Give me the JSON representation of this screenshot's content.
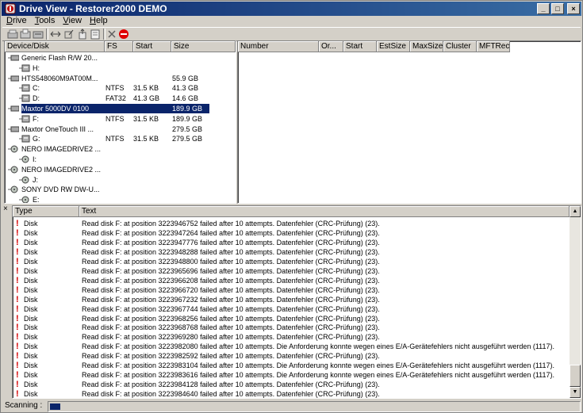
{
  "window": {
    "title": "Drive View - Restorer2000 DEMO"
  },
  "menu": [
    "Drive",
    "Tools",
    "View",
    "Help"
  ],
  "toolbar": {
    "icons": [
      "open-drive-icon",
      "open-image-icon",
      "save-icon",
      "swap-icon",
      "edit-icon",
      "export-icon",
      "properties-icon",
      "delete-icon",
      "stop-icon"
    ]
  },
  "tree": {
    "headers": [
      "Device/Disk",
      "FS",
      "Start",
      "Size"
    ],
    "rows": [
      {
        "name": "Generic Flash R/W 20...",
        "fs": "",
        "start": "",
        "size": "",
        "level": 0,
        "kind": "disk"
      },
      {
        "name": "H:",
        "fs": "",
        "start": "",
        "size": "",
        "level": 1,
        "kind": "partition"
      },
      {
        "name": "HTS548060M9AT00M...",
        "fs": "",
        "start": "",
        "size": "55.9 GB",
        "level": 0,
        "kind": "disk"
      },
      {
        "name": "C:",
        "fs": "NTFS",
        "start": "31.5 KB",
        "size": "41.3 GB",
        "level": 1,
        "kind": "partition"
      },
      {
        "name": "D:",
        "fs": "FAT32",
        "start": "41.3 GB",
        "size": "14.6 GB",
        "level": 1,
        "kind": "partition"
      },
      {
        "name": "Maxtor 5000DV 0100",
        "fs": "",
        "start": "",
        "size": "189.9 GB",
        "level": 0,
        "kind": "disk",
        "selected": true
      },
      {
        "name": "F:",
        "fs": "NTFS",
        "start": "31.5 KB",
        "size": "189.9 GB",
        "level": 1,
        "kind": "partition"
      },
      {
        "name": "Maxtor OneTouch III ...",
        "fs": "",
        "start": "",
        "size": "279.5 GB",
        "level": 0,
        "kind": "disk"
      },
      {
        "name": "G:",
        "fs": "NTFS",
        "start": "31.5 KB",
        "size": "279.5 GB",
        "level": 1,
        "kind": "partition"
      },
      {
        "name": "NERO IMAGEDRIVE2 ...",
        "fs": "",
        "start": "",
        "size": "",
        "level": 0,
        "kind": "cd"
      },
      {
        "name": "I:",
        "fs": "",
        "start": "",
        "size": "",
        "level": 1,
        "kind": "cd"
      },
      {
        "name": "NERO IMAGEDRIVE2 ...",
        "fs": "",
        "start": "",
        "size": "",
        "level": 0,
        "kind": "cd"
      },
      {
        "name": "J:",
        "fs": "",
        "start": "",
        "size": "",
        "level": 1,
        "kind": "cd"
      },
      {
        "name": "SONY DVD RW DW-U...",
        "fs": "",
        "start": "",
        "size": "",
        "level": 0,
        "kind": "cd"
      },
      {
        "name": "E:",
        "fs": "",
        "start": "",
        "size": "",
        "level": 1,
        "kind": "cd"
      }
    ]
  },
  "details": {
    "headers": [
      "Number",
      "Or...",
      "Start",
      "EstSize",
      "MaxSize",
      "Cluster",
      "MFTRec"
    ]
  },
  "log": {
    "close_glyph": "×",
    "scroll_up_glyph": "▲",
    "scroll_down_glyph": "▼",
    "headers": [
      "Type",
      "Text"
    ],
    "rows": [
      {
        "type": "Disk",
        "text": "Read disk F: at position 3223946752 failed after 10 attempts. Datenfehler (CRC-Prüfung) (23)."
      },
      {
        "type": "Disk",
        "text": "Read disk F: at position 3223947264 failed after 10 attempts. Datenfehler (CRC-Prüfung) (23)."
      },
      {
        "type": "Disk",
        "text": "Read disk F: at position 3223947776 failed after 10 attempts. Datenfehler (CRC-Prüfung) (23)."
      },
      {
        "type": "Disk",
        "text": "Read disk F: at position 3223948288 failed after 10 attempts. Datenfehler (CRC-Prüfung) (23)."
      },
      {
        "type": "Disk",
        "text": "Read disk F: at position 3223948800 failed after 10 attempts. Datenfehler (CRC-Prüfung) (23)."
      },
      {
        "type": "Disk",
        "text": "Read disk F: at position 3223965696 failed after 10 attempts. Datenfehler (CRC-Prüfung) (23)."
      },
      {
        "type": "Disk",
        "text": "Read disk F: at position 3223966208 failed after 10 attempts. Datenfehler (CRC-Prüfung) (23)."
      },
      {
        "type": "Disk",
        "text": "Read disk F: at position 3223966720 failed after 10 attempts. Datenfehler (CRC-Prüfung) (23)."
      },
      {
        "type": "Disk",
        "text": "Read disk F: at position 3223967232 failed after 10 attempts. Datenfehler (CRC-Prüfung) (23)."
      },
      {
        "type": "Disk",
        "text": "Read disk F: at position 3223967744 failed after 10 attempts. Datenfehler (CRC-Prüfung) (23)."
      },
      {
        "type": "Disk",
        "text": "Read disk F: at position 3223968256 failed after 10 attempts. Datenfehler (CRC-Prüfung) (23)."
      },
      {
        "type": "Disk",
        "text": "Read disk F: at position 3223968768 failed after 10 attempts. Datenfehler (CRC-Prüfung) (23)."
      },
      {
        "type": "Disk",
        "text": "Read disk F: at position 3223969280 failed after 10 attempts. Datenfehler (CRC-Prüfung) (23)."
      },
      {
        "type": "Disk",
        "text": "Read disk F: at position 3223982080 failed after 10 attempts. Die Anforderung konnte wegen eines E/A-Gerätefehlers nicht ausgeführt werden (1117)."
      },
      {
        "type": "Disk",
        "text": "Read disk F: at position 3223982592 failed after 10 attempts. Datenfehler (CRC-Prüfung) (23)."
      },
      {
        "type": "Disk",
        "text": "Read disk F: at position 3223983104 failed after 10 attempts. Die Anforderung konnte wegen eines E/A-Gerätefehlers nicht ausgeführt werden (1117)."
      },
      {
        "type": "Disk",
        "text": "Read disk F: at position 3223983616 failed after 10 attempts. Die Anforderung konnte wegen eines E/A-Gerätefehlers nicht ausgeführt werden (1117)."
      },
      {
        "type": "Disk",
        "text": "Read disk F: at position 3223984128 failed after 10 attempts. Datenfehler (CRC-Prüfung) (23)."
      },
      {
        "type": "Disk",
        "text": "Read disk F: at position 3223984640 failed after 10 attempts. Datenfehler (CRC-Prüfung) (23)."
      }
    ]
  },
  "status": {
    "label": "Scanning :",
    "progress_fraction": 0.02
  },
  "colors": {
    "title_from": "#0a246a",
    "title_to": "#3a6ea5",
    "selection": "#0a246a",
    "error": "#d40000",
    "face": "#d4d0c8"
  }
}
